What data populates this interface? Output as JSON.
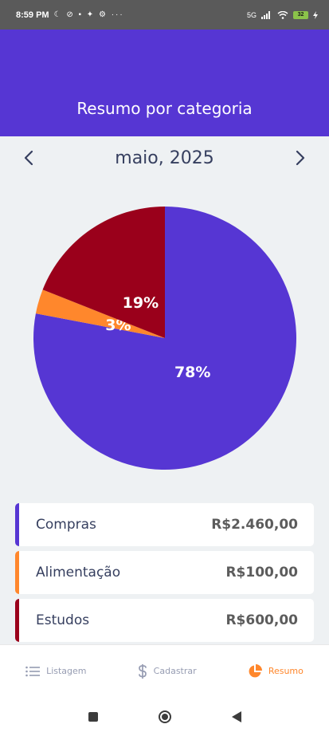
{
  "status_bar": {
    "time": "8:59 PM",
    "icons": "☾ ⊘ ▪ ✦ ⚙ ···",
    "network": "5G",
    "battery": "32"
  },
  "header": {
    "title": "Resumo por categoria"
  },
  "month_nav": {
    "label": "maio, 2025",
    "prev_icon": "chevron-left-icon",
    "next_icon": "chevron-right-icon"
  },
  "chart_data": {
    "type": "pie",
    "title": "",
    "slices": [
      {
        "label": "Compras",
        "percent": 78,
        "value": 2460,
        "color": "#5636d3"
      },
      {
        "label": "Alimentação",
        "percent": 3,
        "value": 100,
        "color": "#ff872c"
      },
      {
        "label": "Estudos",
        "percent": 19,
        "value": 600,
        "color": "#9a001b"
      }
    ],
    "data_labels": [
      "78%",
      "3%",
      "19%"
    ]
  },
  "categories": [
    {
      "name": "Compras",
      "amount": "R$2.460,00",
      "color": "#5636d3"
    },
    {
      "name": "Alimentação",
      "amount": "R$100,00",
      "color": "#ff872c"
    },
    {
      "name": "Estudos",
      "amount": "R$600,00",
      "color": "#9a001b"
    }
  ],
  "bottom_nav": {
    "tabs": [
      {
        "label": "Listagem",
        "icon": "list-icon"
      },
      {
        "label": "Cadastrar",
        "icon": "dollar-sign-icon"
      },
      {
        "label": "Resumo",
        "icon": "pie-chart-icon"
      }
    ],
    "active": "Resumo"
  },
  "system_nav": {
    "icons": [
      "square-icon",
      "circle-icon",
      "back-triangle-icon"
    ]
  }
}
